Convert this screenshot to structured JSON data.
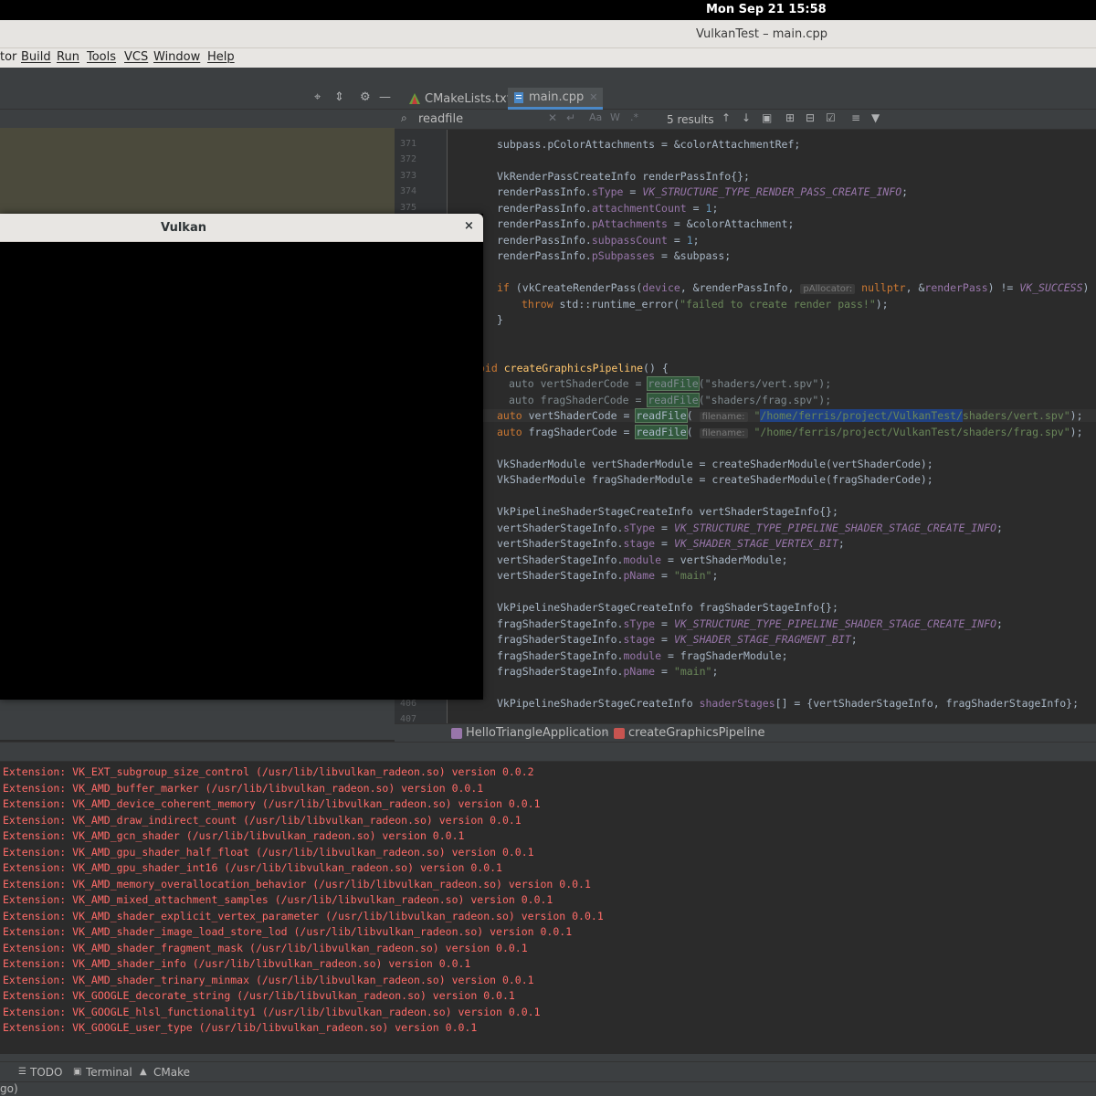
{
  "topbar": {
    "clock": "Mon Sep 21  15:58"
  },
  "window": {
    "title": "VulkanTest – main.cpp"
  },
  "menu": [
    "tor",
    "Build",
    "Run",
    "Tools",
    "VCS",
    "Window",
    "Help"
  ],
  "left_toolbar": {
    "icons": [
      "crosshair-icon",
      "collapse-icon",
      "gear-icon",
      "hide-icon"
    ]
  },
  "tabs": [
    {
      "label": "CMakeLists.txt",
      "icon": "cmake-icon",
      "color": "#6b9e3b"
    },
    {
      "label": "main.cpp",
      "icon": "cpp-file-icon",
      "color": "#4a88c7",
      "active": true
    }
  ],
  "search": {
    "query": "readfile",
    "results": "5 results"
  },
  "gutter": {
    "lines": [
      "371",
      "372",
      "373",
      "374",
      "375",
      "",
      "",
      "",
      "",
      "",
      "",
      "",
      "",
      "",
      "",
      "",
      "",
      "",
      "",
      "",
      "",
      "",
      "",
      "",
      "",
      "",
      "",
      "",
      "",
      "",
      "",
      "",
      "",
      "",
      "",
      "",
      "406",
      "407"
    ]
  },
  "code": {
    "l0": "subpass.pColorAttachments = &colorAttachmentRef;",
    "l2a": "VkRenderPassCreateInfo renderPassInfo{};",
    "l3a": "renderPassInfo.",
    "l3b": "sType",
    "l3c": " = ",
    "l3d": "VK_STRUCTURE_TYPE_RENDER_PASS_CREATE_INFO",
    "l3e": ";",
    "l4a": "renderPassInfo.",
    "l4b": "attachmentCount",
    "l4c": " = ",
    "l4d": "1",
    "l4e": ";",
    "l5a": "renderPassInfo.",
    "l5b": "pAttachments",
    "l5c": " = &colorAttachment;",
    "l6a": "renderPassInfo.",
    "l6b": "subpassCount",
    "l6c": " = ",
    "l6d": "1",
    "l6e": ";",
    "l7a": "renderPassInfo.",
    "l7b": "pSubpasses",
    "l7c": " = &subpass;",
    "l9a": "if",
    "l9b": " (vkCreateRenderPass(",
    "l9c": "device",
    "l9d": ", &renderPassInfo, ",
    "l9hint": "pAllocator:",
    "l9e": " nullptr",
    "l9f": ", &",
    "l9g": "renderPass",
    "l9h": ") != ",
    "l9i": "VK_SUCCESS",
    "l9j": ") {",
    "l10a": "throw",
    "l10b": " std::runtime_error(",
    "l10c": "\"failed to create render pass!\"",
    "l10d": ");",
    "l11": "}",
    "l14a": "oid",
    "l14b": "createGraphicsPipeline",
    "l14c": "() {",
    "l15a": "auto vertShaderCode = ",
    "l15b": "readFile",
    "l15c": "(\"shaders/vert.spv\");",
    "l16a": "auto fragShaderCode = ",
    "l16b": "readFile",
    "l16c": "(\"shaders/frag.spv\");",
    "l17a": "auto",
    "l17b": " vertShaderCode = ",
    "l17c": "readFile",
    "l17d": "( ",
    "l17hint": "filename:",
    "l17e": " \"",
    "l17f": "/home/ferris/project/VulkanTest/",
    "l17g": "shaders/vert.spv\"",
    "l17h": ");",
    "l18a": "auto",
    "l18b": " fragShaderCode = ",
    "l18c": "readFile",
    "l18d": "( ",
    "l18hint": "filename:",
    "l18e": " \"/home/ferris/project/VulkanTest/shaders/frag.spv\"",
    "l18f": ");",
    "l20": "VkShaderModule vertShaderModule = createShaderModule(vertShaderCode);",
    "l21": "VkShaderModule fragShaderModule = createShaderModule(fragShaderCode);",
    "l23": "VkPipelineShaderStageCreateInfo vertShaderStageInfo{};",
    "l24a": "vertShaderStageInfo.",
    "l24b": "sType",
    "l24c": " = ",
    "l24d": "VK_STRUCTURE_TYPE_PIPELINE_SHADER_STAGE_CREATE_INFO",
    "l24e": ";",
    "l25a": "vertShaderStageInfo.",
    "l25b": "stage",
    "l25c": " = ",
    "l25d": "VK_SHADER_STAGE_VERTEX_BIT",
    "l25e": ";",
    "l26a": "vertShaderStageInfo.",
    "l26b": "module",
    "l26c": " = vertShaderModule;",
    "l27a": "vertShaderStageInfo.",
    "l27b": "pName",
    "l27c": " = ",
    "l27d": "\"main\"",
    "l27e": ";",
    "l29": "VkPipelineShaderStageCreateInfo fragShaderStageInfo{};",
    "l30a": "fragShaderStageInfo.",
    "l30b": "sType",
    "l30c": " = ",
    "l30d": "VK_STRUCTURE_TYPE_PIPELINE_SHADER_STAGE_CREATE_INFO",
    "l30e": ";",
    "l31a": "fragShaderStageInfo.",
    "l31b": "stage",
    "l31c": " = ",
    "l31d": "VK_SHADER_STAGE_FRAGMENT_BIT",
    "l31e": ";",
    "l32a": "fragShaderStageInfo.",
    "l32b": "module",
    "l32c": " = fragShaderModule;",
    "l33a": "fragShaderStageInfo.",
    "l33b": "pName",
    "l33c": " = ",
    "l33d": "\"main\"",
    "l33e": ";",
    "l35a": "VkPipelineShaderStageCreateInfo ",
    "l35b": "shaderStages",
    "l35c": "[] = {vertShaderStageInfo, fragShaderStageInfo};"
  },
  "breadcrumb": {
    "class_name": "HelloTriangleApplication",
    "method_name": "createGraphicsPipeline"
  },
  "console": [
    "Extension: VK_EXT_subgroup_size_control (/usr/lib/libvulkan_radeon.so) version 0.0.2",
    "Extension: VK_AMD_buffer_marker (/usr/lib/libvulkan_radeon.so) version 0.0.1",
    "Extension: VK_AMD_device_coherent_memory (/usr/lib/libvulkan_radeon.so) version 0.0.1",
    "Extension: VK_AMD_draw_indirect_count (/usr/lib/libvulkan_radeon.so) version 0.0.1",
    "Extension: VK_AMD_gcn_shader (/usr/lib/libvulkan_radeon.so) version 0.0.1",
    "Extension: VK_AMD_gpu_shader_half_float (/usr/lib/libvulkan_radeon.so) version 0.0.1",
    "Extension: VK_AMD_gpu_shader_int16 (/usr/lib/libvulkan_radeon.so) version 0.0.1",
    "Extension: VK_AMD_memory_overallocation_behavior (/usr/lib/libvulkan_radeon.so) version 0.0.1",
    "Extension: VK_AMD_mixed_attachment_samples (/usr/lib/libvulkan_radeon.so) version 0.0.1",
    "Extension: VK_AMD_shader_explicit_vertex_parameter (/usr/lib/libvulkan_radeon.so) version 0.0.1",
    "Extension: VK_AMD_shader_image_load_store_lod (/usr/lib/libvulkan_radeon.so) version 0.0.1",
    "Extension: VK_AMD_shader_fragment_mask (/usr/lib/libvulkan_radeon.so) version 0.0.1",
    "Extension: VK_AMD_shader_info (/usr/lib/libvulkan_radeon.so) version 0.0.1",
    "Extension: VK_AMD_shader_trinary_minmax (/usr/lib/libvulkan_radeon.so) version 0.0.1",
    "Extension: VK_GOOGLE_decorate_string (/usr/lib/libvulkan_radeon.so) version 0.0.1",
    "Extension: VK_GOOGLE_hlsl_functionality1 (/usr/lib/libvulkan_radeon.so) version 0.0.1",
    "Extension: VK_GOOGLE_user_type (/usr/lib/libvulkan_radeon.so) version 0.0.1"
  ],
  "toolwindows": {
    "todo": "TODO",
    "terminal": "Terminal",
    "cmake": "CMake"
  },
  "statusbar": {
    "text": "go)"
  },
  "vulkan_window": {
    "title": "Vulkan",
    "close": "×"
  },
  "colors": {
    "accent": "#4a88c7",
    "console_error": "#ff6b68",
    "search_match": "#32593d"
  }
}
